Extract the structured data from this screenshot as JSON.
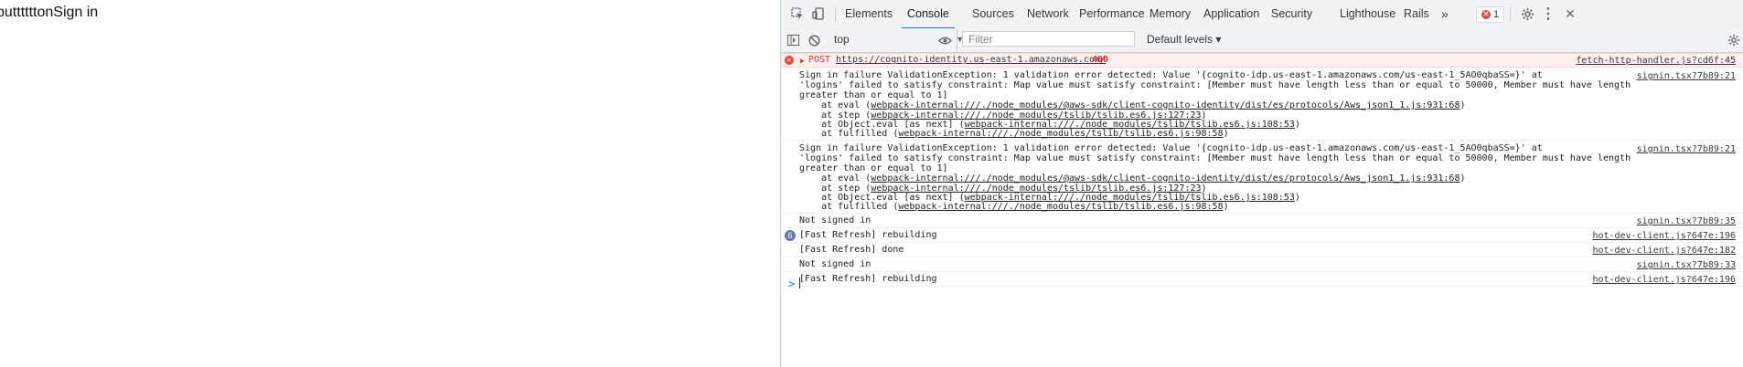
{
  "page": {
    "text": "buttttttonSign in"
  },
  "devtools": {
    "tabs": [
      "Elements",
      "Console",
      "Sources",
      "Network",
      "Performance",
      "Memory",
      "Application",
      "Security",
      "Lighthouse",
      "Rails"
    ],
    "more_tabs": "»",
    "error_count": "1",
    "toolbar": {
      "context": "top",
      "filter_placeholder": "Filter",
      "levels": "Default levels ▾"
    },
    "console": {
      "error": {
        "method": "POST",
        "url": "https://cognito-identity.us-east-1.amazonaws.com/",
        "status": "400",
        "source": "fetch-http-handler.js?cd6f:45"
      },
      "failures": [
        {
          "l1": "Sign in failure ValidationException: 1 validation error detected: Value '{cognito-idp.us-east-1.amazonaws.com/us-east-1_5AO0qbaSS=}' at",
          "l2": "'logins' failed to satisfy constraint: Map value must satisfy constraint: [Member must have length less than or equal to 50000, Member must have length",
          "l3": "greater than or equal to 1]",
          "source": "signin.tsx?7b89:21",
          "stack": [
            {
              "pre": "    at eval (",
              "link": "webpack-internal:///./node_modules/@aws-sdk/client-cognito-identity/dist/es/protocols/Aws_json1_1.js:931:68",
              "post": ")"
            },
            {
              "pre": "    at step (",
              "link": "webpack-internal:///./node_modules/tslib/tslib.es6.js:127:23",
              "post": ")"
            },
            {
              "pre": "    at Object.eval [as next] (",
              "link": "webpack-internal:///./node_modules/tslib/tslib.es6.js:108:53",
              "post": ")"
            },
            {
              "pre": "    at fulfilled (",
              "link": "webpack-internal:///./node_modules/tslib/tslib.es6.js:98:58",
              "post": ")"
            }
          ]
        },
        {
          "l1": "Sign in failure ValidationException: 1 validation error detected: Value '{cognito-idp.us-east-1.amazonaws.com/us-east-1_5AO0qbaSS=}' at",
          "l2": "'logins' failed to satisfy constraint: Map value must satisfy constraint: [Member must have length less than or equal to 50000, Member must have length",
          "l3": "greater than or equal to 1]",
          "source": "signin.tsx?7b89:21",
          "stack": [
            {
              "pre": "    at eval (",
              "link": "webpack-internal:///./node_modules/@aws-sdk/client-cognito-identity/dist/es/protocols/Aws_json1_1.js:931:68",
              "post": ")"
            },
            {
              "pre": "    at step (",
              "link": "webpack-internal:///./node_modules/tslib/tslib.es6.js:127:23",
              "post": ")"
            },
            {
              "pre": "    at Object.eval [as next] (",
              "link": "webpack-internal:///./node_modules/tslib/tslib.es6.js:108:53",
              "post": ")"
            },
            {
              "pre": "    at fulfilled (",
              "link": "webpack-internal:///./node_modules/tslib/tslib.es6.js:98:58",
              "post": ")"
            }
          ]
        }
      ],
      "messages": [
        {
          "text": "Not signed in",
          "source": "signin.tsx?7b89:35",
          "count": ""
        },
        {
          "text": "[Fast Refresh] rebuilding",
          "source": "hot-dev-client.js?647e:196",
          "count": "6"
        },
        {
          "text": "[Fast Refresh] done",
          "source": "hot-dev-client.js?647e:182",
          "count": ""
        },
        {
          "text": "Not signed in",
          "source": "signin.tsx?7b89:33",
          "count": ""
        },
        {
          "text": "[Fast Refresh] rebuilding",
          "source": "hot-dev-client.js?647e:196",
          "count": ""
        }
      ],
      "prompt": ">"
    }
  }
}
